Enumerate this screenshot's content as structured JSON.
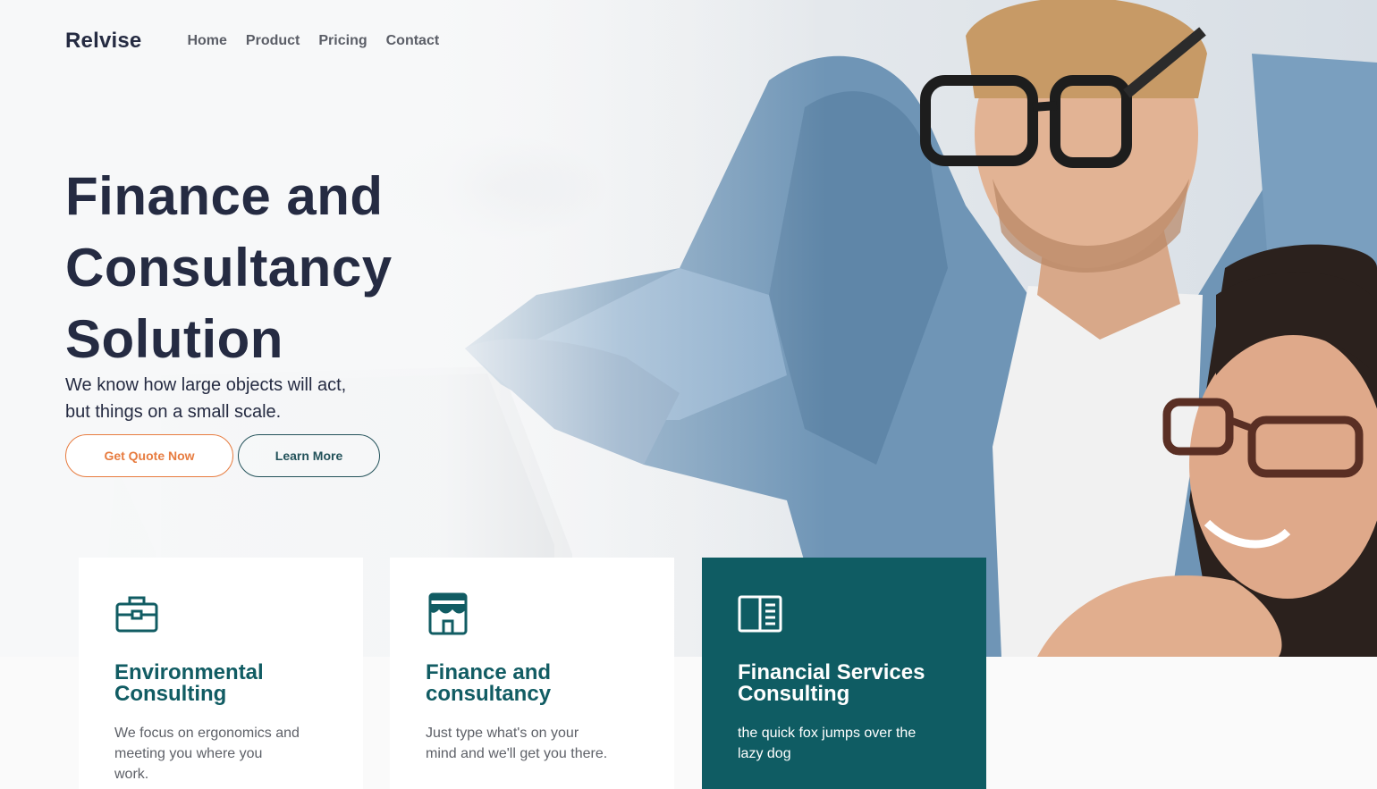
{
  "nav": {
    "brand": "Relvise",
    "links": [
      "Home",
      "Product",
      "Pricing",
      "Contact"
    ]
  },
  "hero": {
    "title_lines": [
      "Finance and",
      "Consultancy",
      "Solution"
    ],
    "subtitle_lines": [
      "We know how large objects will act,",
      "but things on a small scale."
    ],
    "primary_button": "Get Quote Now",
    "secondary_button": "Learn More",
    "image_icon": "two-people-at-laptop-photo"
  },
  "cards": [
    {
      "icon": "briefcase-icon",
      "title_lines": [
        "Environmental",
        "Consulting"
      ],
      "text_lines": [
        "We focus on ergonomics and",
        "meeting you where you",
        "work."
      ]
    },
    {
      "icon": "store-icon",
      "title_lines": [
        "Finance and",
        "consultancy"
      ],
      "text_lines": [
        "Just type what's on your",
        "mind and we'll get you there."
      ]
    },
    {
      "icon": "book-icon",
      "title_lines": [
        "Financial Services",
        "Consulting"
      ],
      "text_lines": [
        "the quick fox jumps over the",
        "lazy dog"
      ]
    }
  ],
  "colors": {
    "primary_dark": "#252b42",
    "teal": "#115c63",
    "teal_card": "#0f5c63",
    "orange": "#e77c40"
  }
}
